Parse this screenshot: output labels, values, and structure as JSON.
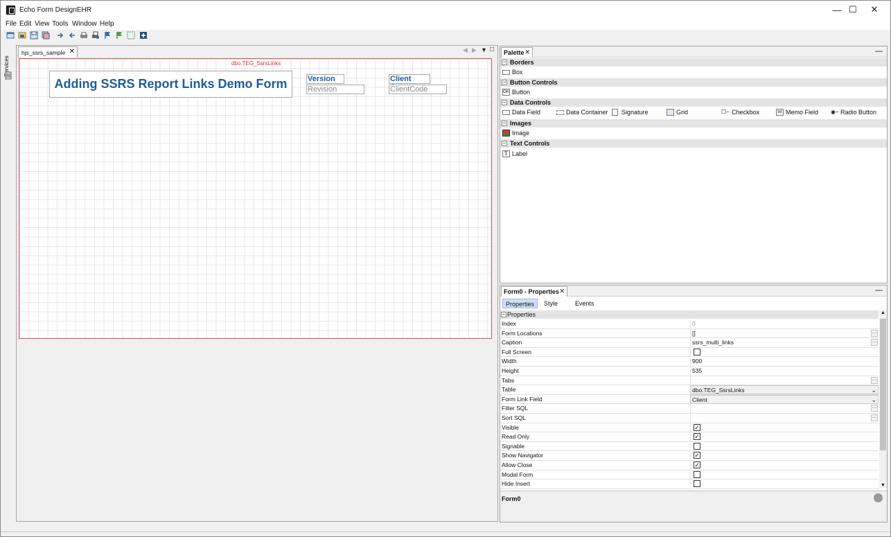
{
  "window": {
    "title": "Echo Form DesignEHR",
    "controls": {
      "minimize": "—",
      "maximize": "☐",
      "close": "✕"
    }
  },
  "menu": [
    "File",
    "Edit",
    "View",
    "Tools",
    "Window",
    "Help"
  ],
  "toolbar": {
    "icons": [
      "new-form-icon",
      "open-icon",
      "save-icon",
      "save-all-icon",
      "forward-icon",
      "back-icon",
      "print-icon",
      "print-preview-icon",
      "flag-blue-icon",
      "flag-green-icon",
      "select-icon",
      "add-icon"
    ]
  },
  "sidebar": {
    "services_label": "Services"
  },
  "editor": {
    "tab_label": "hjs_ssrs_sample",
    "tab_close": "✕",
    "nav_prev": "◀",
    "nav_next": "▶",
    "nav_menu": "▼",
    "nav_max": "□",
    "table_name": "dbo.TEG_SsrsLinks",
    "form_title": "Adding SSRS Report Links Demo Form",
    "fields": [
      {
        "label": "Version",
        "value": "Revision"
      },
      {
        "label": "Client Co...",
        "value": "ClientCode"
      }
    ]
  },
  "palette": {
    "title": "Palette",
    "close": "✕",
    "minimize": "—",
    "categories": [
      {
        "name": "Borders",
        "toggle": "−",
        "items": [
          {
            "label": "Box",
            "icon": "box-icon"
          }
        ]
      },
      {
        "name": "Button Controls",
        "toggle": "−",
        "items": [
          {
            "label": "Button",
            "icon": "button-icon",
            "glyph": "OK"
          }
        ]
      },
      {
        "name": "Data Controls",
        "toggle": "−",
        "items": [
          {
            "label": "Data Field",
            "icon": "data-field-icon"
          },
          {
            "label": "Data Container",
            "icon": "data-container-icon"
          },
          {
            "label": "Signature",
            "icon": "signature-icon"
          },
          {
            "label": "Grid",
            "icon": "grid-icon"
          },
          {
            "label": "Checkbox",
            "icon": "checkbox-icon",
            "glyph": "☐−"
          },
          {
            "label": "Memo Field",
            "icon": "memo-field-icon",
            "glyph": "txt"
          },
          {
            "label": "Radio Button",
            "icon": "radio-button-icon",
            "glyph": "◉−"
          }
        ]
      },
      {
        "name": "Images",
        "toggle": "−",
        "items": [
          {
            "label": "Image",
            "icon": "image-icon"
          }
        ]
      },
      {
        "name": "Text Controls",
        "toggle": "−",
        "items": [
          {
            "label": "Label",
            "icon": "label-icon",
            "glyph": "T"
          }
        ]
      }
    ]
  },
  "properties": {
    "title": "Form0 - Properties",
    "close": "✕",
    "minimize": "—",
    "tabs": [
      "Properties",
      "Style",
      "Events"
    ],
    "active_tab": "Properties",
    "category": "Properties",
    "category_toggle": "−",
    "rows": [
      {
        "name": "Index",
        "value": "0",
        "kind": "grey"
      },
      {
        "name": "Form Locations",
        "value": "[]",
        "kind": "ellipsis"
      },
      {
        "name": "Caption",
        "value": "ssrs_multi_links",
        "kind": "ellipsis"
      },
      {
        "name": "Full Screen",
        "checked": false,
        "kind": "checkbox"
      },
      {
        "name": "Width",
        "value": "900",
        "kind": "text"
      },
      {
        "name": "Height",
        "value": "535",
        "kind": "text"
      },
      {
        "name": "Tabs",
        "value": "",
        "kind": "ellipsis"
      },
      {
        "name": "Table",
        "value": "dbo.TEG_SsrsLinks",
        "kind": "combo"
      },
      {
        "name": "Form Link Field",
        "value": "Client",
        "kind": "combo"
      },
      {
        "name": "Filter SQL",
        "value": "",
        "kind": "ellipsis"
      },
      {
        "name": "Sort SQL",
        "value": "",
        "kind": "ellipsis"
      },
      {
        "name": "Visible",
        "checked": true,
        "kind": "checkbox"
      },
      {
        "name": "Read Only",
        "checked": true,
        "kind": "checkbox"
      },
      {
        "name": "Signable",
        "checked": false,
        "kind": "checkbox"
      },
      {
        "name": "Show Navigator",
        "checked": true,
        "kind": "checkbox"
      },
      {
        "name": "Allow Close",
        "checked": true,
        "kind": "checkbox"
      },
      {
        "name": "Modal Form",
        "checked": false,
        "kind": "checkbox"
      },
      {
        "name": "Hide Insert",
        "checked": false,
        "kind": "checkbox"
      }
    ],
    "footer_name": "Form0",
    "scroll_up": "▲",
    "scroll_down": "▼"
  },
  "colors": {
    "title_text": "#1f5c99",
    "canvas_border": "#e05050",
    "table_name": "#e03030",
    "category_bg": "#e4e4e4"
  }
}
